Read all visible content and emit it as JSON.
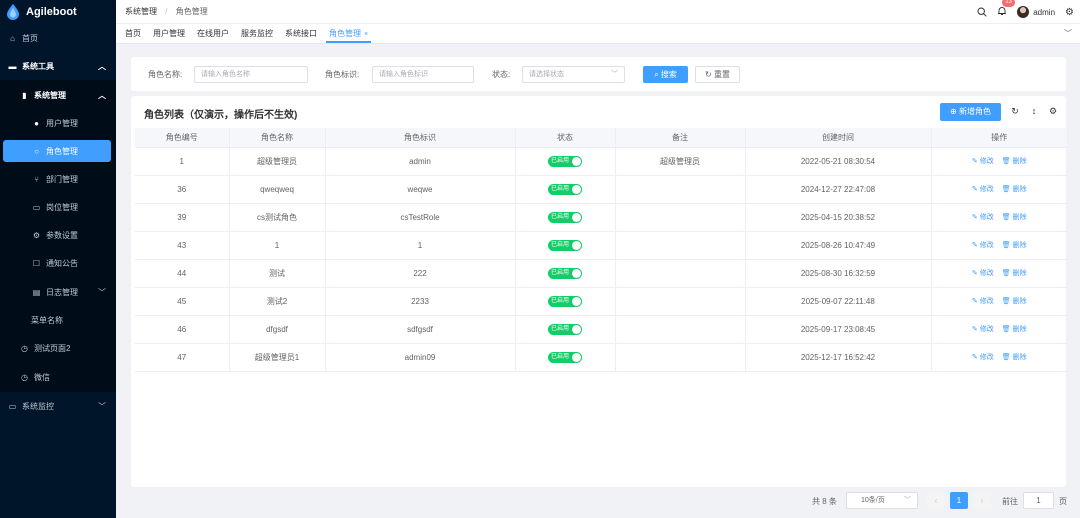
{
  "sidebar": {
    "logo": "Agileboot",
    "items": [
      {
        "label": "首页",
        "icon": "home-icon"
      },
      {
        "label": "系统工具",
        "icon": "setting-icon"
      },
      {
        "label": "系统管理",
        "icon": "stats-icon"
      },
      {
        "label": "用户管理",
        "icon": "user-icon"
      },
      {
        "label": "角色管理",
        "icon": "user-icon"
      },
      {
        "label": "部门管理",
        "icon": "tree-icon"
      },
      {
        "label": "岗位管理",
        "icon": "post-icon"
      },
      {
        "label": "参数设置",
        "icon": "gear-icon"
      },
      {
        "label": "通知公告",
        "icon": "notice-icon"
      },
      {
        "label": "日志管理",
        "icon": "log-icon"
      },
      {
        "label": "菜单名称",
        "icon": ""
      },
      {
        "label": "测试页面2",
        "icon": "clock-icon"
      },
      {
        "label": "微信",
        "icon": "clock-icon"
      },
      {
        "label": "系统监控",
        "icon": "monitor-icon"
      }
    ]
  },
  "breadcrumb": {
    "parent": "系统管理",
    "sep": "/",
    "current": "角色管理"
  },
  "navbar": {
    "badge": "13",
    "user": "admin"
  },
  "tags": [
    "首页",
    "用户管理",
    "在线用户",
    "服务监控",
    "系统接口",
    "角色管理"
  ],
  "tag_close": "×",
  "search": {
    "role_name_label": "角色名称:",
    "role_name_placeholder": "请输入角色名称",
    "role_key_label": "角色标识:",
    "role_key_placeholder": "请输入角色标识",
    "status_label": "状态:",
    "status_placeholder": "请选择状态",
    "search_btn": "搜索",
    "reset_btn": "重置"
  },
  "table": {
    "title": "角色列表（仅演示，操作后不生效)",
    "add_btn": "新增角色",
    "headers": [
      "角色编号",
      "角色名称",
      "角色标识",
      "状态",
      "备注",
      "创建时间",
      "操作"
    ],
    "switch_text": "已启用",
    "edit": "修改",
    "delete": "删除",
    "rows": [
      {
        "id": "1",
        "name": "超级管理员",
        "key": "admin",
        "remark": "超级管理员",
        "time": "2022-05-21 08:30:54"
      },
      {
        "id": "36",
        "name": "qweqweq",
        "key": "weqwe",
        "remark": "",
        "time": "2024-12-27 22:47:08"
      },
      {
        "id": "39",
        "name": "cs测试角色",
        "key": "csTestRole",
        "remark": "",
        "time": "2025-04-15 20:38:52"
      },
      {
        "id": "43",
        "name": "1",
        "key": "1",
        "remark": "",
        "time": "2025-08-26 10:47:49"
      },
      {
        "id": "44",
        "name": "测试",
        "key": "222",
        "remark": "",
        "time": "2025-08-30 16:32:59"
      },
      {
        "id": "45",
        "name": "测试2",
        "key": "2233",
        "remark": "",
        "time": "2025-09-07 22:11:48"
      },
      {
        "id": "46",
        "name": "dfgsdf",
        "key": "sdfgsdf",
        "remark": "",
        "time": "2025-09-17 23:08:45"
      },
      {
        "id": "47",
        "name": "超级管理员1",
        "key": "admin09",
        "remark": "",
        "time": "2025-12-17 16:52:42"
      }
    ]
  },
  "pagination": {
    "total": "共 8 条",
    "page_size": "10条/页",
    "current_page": "1",
    "goto_label": "前往",
    "goto_value": "1",
    "page_suffix": "页"
  },
  "colors": {
    "primary": "#409eff",
    "sidebar": "#001529",
    "switch_on": "#13ce66"
  }
}
